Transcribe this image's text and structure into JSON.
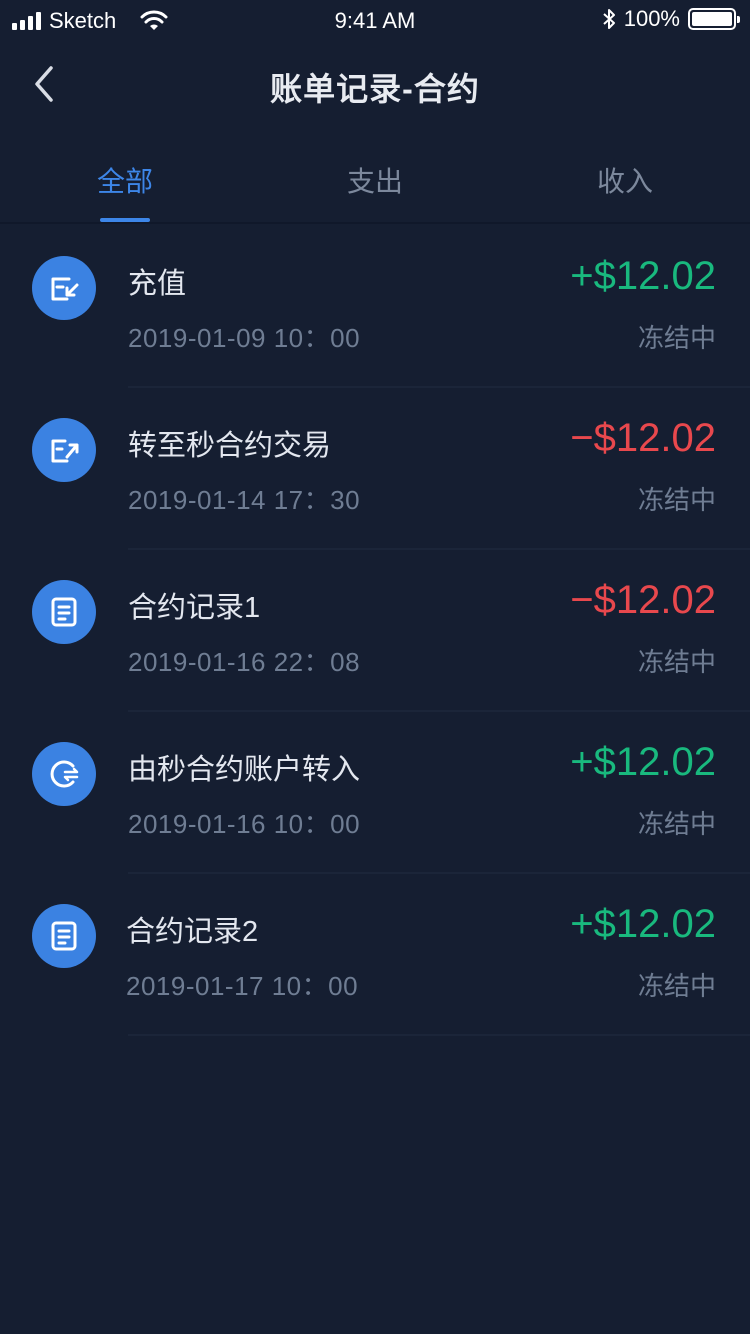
{
  "status_bar": {
    "carrier": "Sketch",
    "time": "9:41 AM",
    "battery": "100%",
    "icons": [
      "signal-icon",
      "wifi-icon",
      "bluetooth-icon",
      "battery-icon"
    ]
  },
  "nav": {
    "title": "账单记录-合约",
    "back_icon": "chevron-left-icon"
  },
  "tabs": [
    {
      "label": "全部",
      "active": true
    },
    {
      "label": "支出",
      "active": false
    },
    {
      "label": "收入",
      "active": false
    }
  ],
  "records": [
    {
      "title": "充值",
      "time": "2019-01-09 10：00",
      "amount": "+$12.02",
      "status": "冻结中",
      "icon": "deposit-icon"
    },
    {
      "title": "转至秒合约交易",
      "time": "2019-01-14 17：30",
      "amount": "−$12.02",
      "status": "冻结中",
      "icon": "transfer-out-icon"
    },
    {
      "title": "合约记录1",
      "time": "2019-01-16 22：08",
      "amount": "−$12.02",
      "status": "冻结中",
      "icon": "document-icon"
    },
    {
      "title": "由秒合约账户转入",
      "time": "2019-01-16 10：00",
      "amount": "+$12.02",
      "status": "冻结中",
      "icon": "transfer-in-icon"
    },
    {
      "title": "合约记录2",
      "time": "2019-01-17 10：00",
      "amount": "+$12.02",
      "status": "冻结中",
      "icon": "document-icon"
    }
  ],
  "colors": {
    "background": "#151e31",
    "accent": "#3d86e8",
    "positive": "#19b97e",
    "negative": "#e8484d",
    "muted": "#6f7d93"
  }
}
